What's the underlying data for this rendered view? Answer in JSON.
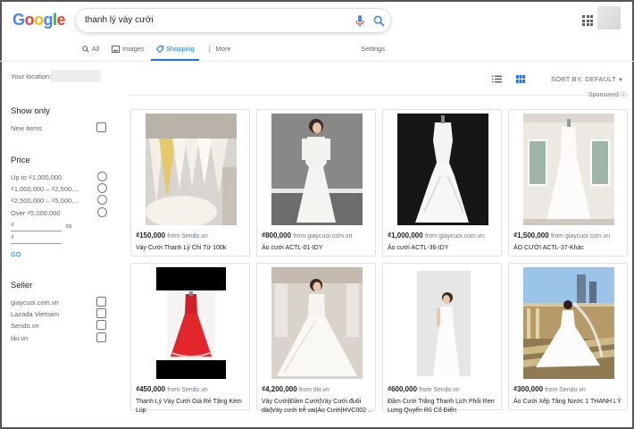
{
  "search": {
    "query": "thanh lý váy cưới"
  },
  "logo": "Google",
  "tabs": [
    {
      "label": "All",
      "icon": "search-icon"
    },
    {
      "label": "Images",
      "icon": "image-icon"
    },
    {
      "label": "Shopping",
      "icon": "tag-icon"
    },
    {
      "label": "More",
      "icon": "more-icon"
    }
  ],
  "settings_label": "Settings",
  "location_label": "Your location:",
  "filters": {
    "show_only": {
      "title": "Show only",
      "items": [
        "New items"
      ]
    },
    "price": {
      "title": "Price",
      "ranges": [
        "Up to ₫1,000,000",
        "₫1,000,000 – ₫2,500,...",
        "₫2,500,000 – ₫5,000,...",
        "Over ₫5,000,000"
      ],
      "min_placeholder": "₫",
      "max_placeholder": "₫",
      "to_label": "to",
      "go_label": "GO"
    },
    "seller": {
      "title": "Seller",
      "items": [
        "giaycuoi.com.vn",
        "Lazada Vietnam",
        "Sendo.vn",
        "tiki.vn"
      ]
    }
  },
  "toolbar": {
    "sort_label": "SORT BY: DEFAULT",
    "sponsored_label": "Sponsored"
  },
  "colors": {
    "accent": "#1a73e8",
    "border": "#dfe1e5"
  },
  "products": [
    {
      "price": "₫150,000",
      "from": "from Sendo.vn",
      "title": "Váy Cưới Thanh Lý Chỉ Từ 100k"
    },
    {
      "price": "₫800,000",
      "from": "from giaycuoi.com.vn",
      "title": "Áo cưới ACTL-01-IDY"
    },
    {
      "price": "₫1,000,000",
      "from": "from giaycuoi.com.vn",
      "title": "Áo cưới ACTL-36-IDY"
    },
    {
      "price": "₫1,500,000",
      "from": "from giaycuoi.com.vn",
      "title": "ÁO CƯỚI ACTL-37-Khác"
    },
    {
      "price": "₫450,000",
      "from": "from Sendo.vn",
      "title": "Thanh Lý Váy Cưới Giá Rẻ Tặng Kèm Lúp"
    },
    {
      "price": "₫4,200,000",
      "from": "from tiki.vn",
      "title": "Váy Cưới|Đầm Cưới|Váy Cưới đuôi dài|Váy cưới trễ vai|Áo Cưới|HVC002 ..."
    },
    {
      "price": "₫600,000",
      "from": "from Sendo.vn",
      "title": "Đầm Cưới Trắng Thanh Lịch Phối Ren Lưng Quyến Rũ Cổ Điển"
    },
    {
      "price": "₫300,000",
      "from": "from Sendo.vn",
      "title": "Áo Cưới Xếp Tầng Nước 1 THANH LÝ"
    }
  ]
}
